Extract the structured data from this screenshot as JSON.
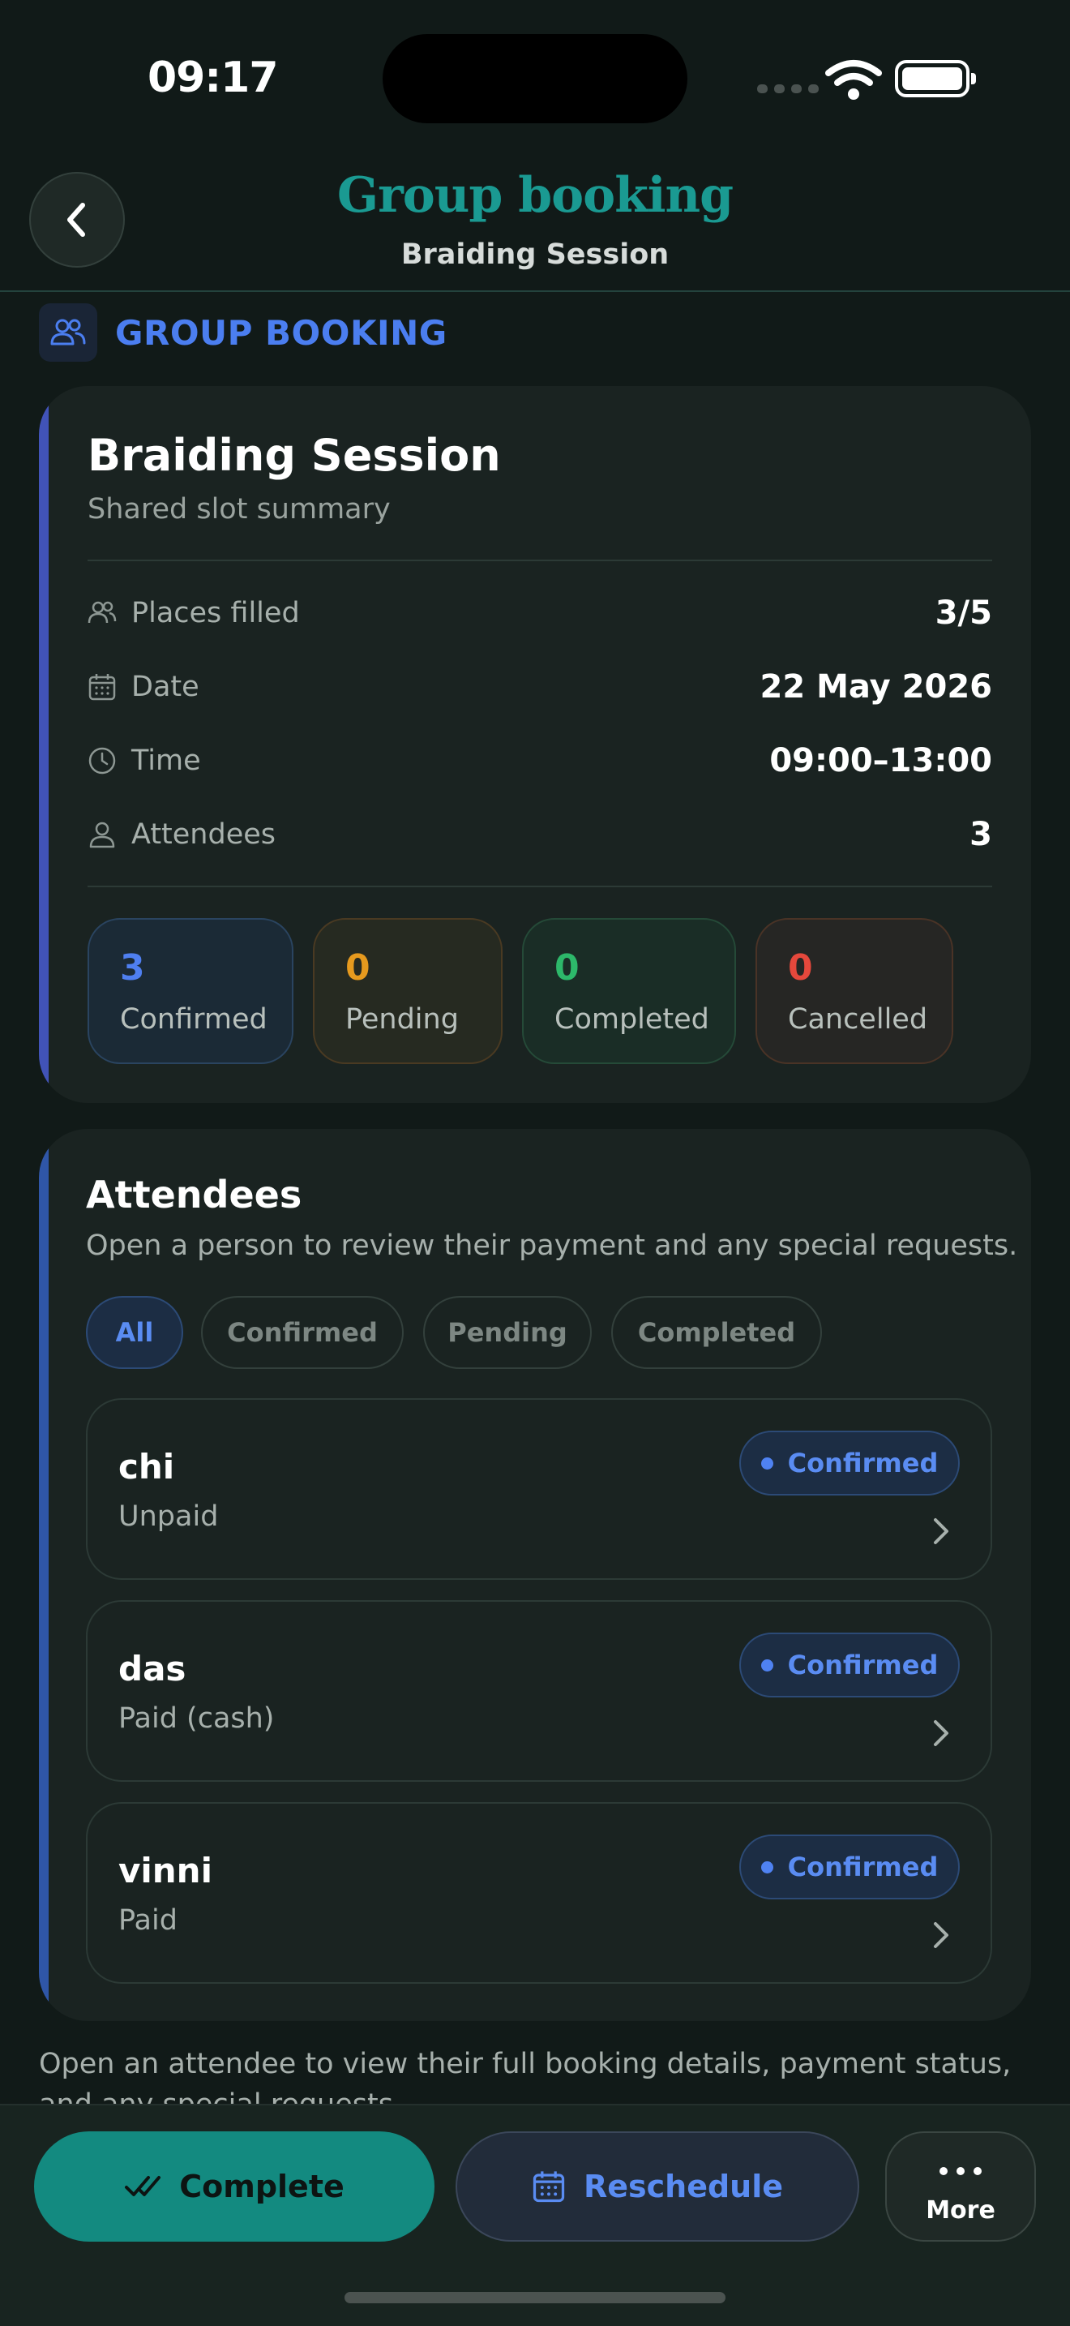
{
  "status_bar": {
    "time": "09:17"
  },
  "header": {
    "title": "Group booking",
    "subtitle": "Braiding Session"
  },
  "section": {
    "label": "GROUP BOOKING"
  },
  "summary": {
    "title": "Braiding Session",
    "subtitle": "Shared slot summary",
    "rows": [
      {
        "icon": "users-icon",
        "label": "Places filled",
        "value": "3/5"
      },
      {
        "icon": "calendar-icon",
        "label": "Date",
        "value": "22 May 2026"
      },
      {
        "icon": "clock-icon",
        "label": "Time",
        "value": "09:00–13:00"
      },
      {
        "icon": "person-icon",
        "label": "Attendees",
        "value": "3"
      }
    ],
    "stats": [
      {
        "count": "3",
        "label": "Confirmed",
        "color": "#4f7ff0"
      },
      {
        "count": "0",
        "label": "Pending",
        "color": "#e69a1e"
      },
      {
        "count": "0",
        "label": "Completed",
        "color": "#2db86a"
      },
      {
        "count": "0",
        "label": "Cancelled",
        "color": "#e5483c"
      }
    ]
  },
  "attendees": {
    "title": "Attendees",
    "subtitle": "Open a person to review their payment and any special requests.",
    "filters": [
      "All",
      "Confirmed",
      "Pending",
      "Completed"
    ],
    "active_filter": "All",
    "people": [
      {
        "name": "chi",
        "payment": "Unpaid",
        "status": "Confirmed"
      },
      {
        "name": "das",
        "payment": "Paid (cash)",
        "status": "Confirmed"
      },
      {
        "name": "vinni",
        "payment": "Paid",
        "status": "Confirmed"
      }
    ]
  },
  "footnote": "Open an attendee to view their full booking details, payment status, and any special requests.",
  "actions": {
    "complete": "Complete",
    "reschedule": "Reschedule",
    "more": "More"
  },
  "colors": {
    "accent_teal": "#138a80",
    "accent_blue": "#4f7ff0",
    "background": "#111a18"
  }
}
